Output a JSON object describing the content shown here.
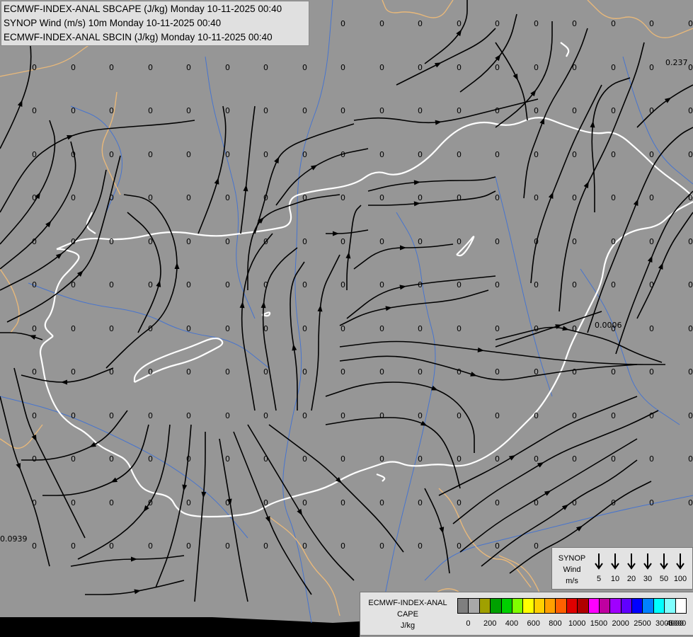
{
  "header": {
    "line1": "ECMWF-INDEX-ANAL SBCAPE (J/kg) Monday 10-11-2025 00:40",
    "line2": "SYNOP Wind (m/s) 10m Monday 10-11-2025 00:40",
    "line3": "ECMWF-INDEX-ANAL SBCIN (J/kg) Monday 10-11-2025 00:40"
  },
  "colors": {
    "land": "#969696",
    "outer_border": "#e8b87a",
    "country_border": "#ffffff",
    "river": "#3a6fd8",
    "streamline": "#000000"
  },
  "grid_values": {
    "zero_label": "0",
    "special": [
      "0.237",
      "0.0006",
      "0.0939"
    ]
  },
  "wind_legend": {
    "title_line1": "SYNOP",
    "title_line2": "Wind",
    "title_line3": "m/s",
    "speeds": [
      "5",
      "10",
      "20",
      "30",
      "50",
      "100"
    ]
  },
  "cape_legend": {
    "title_line1": "ECMWF-INDEX-ANAL",
    "title_line2": "CAPE",
    "title_line3": "J/kg",
    "colors": [
      "#7f7f7f",
      "#a8a8a8",
      "#a0a000",
      "#00a000",
      "#00d000",
      "#80ff00",
      "#ffff00",
      "#ffd000",
      "#ffa000",
      "#ff6000",
      "#e00000",
      "#b00000",
      "#ff00ff",
      "#c000a0",
      "#a000ff",
      "#6000ff",
      "#0000ff",
      "#0080ff",
      "#00ffff",
      "#80ffff",
      "#ffffff"
    ],
    "ticks": [
      "0",
      "200",
      "400",
      "600",
      "800",
      "1000",
      "1500",
      "2000",
      "2500",
      "3000",
      "4000",
      "6000"
    ]
  }
}
